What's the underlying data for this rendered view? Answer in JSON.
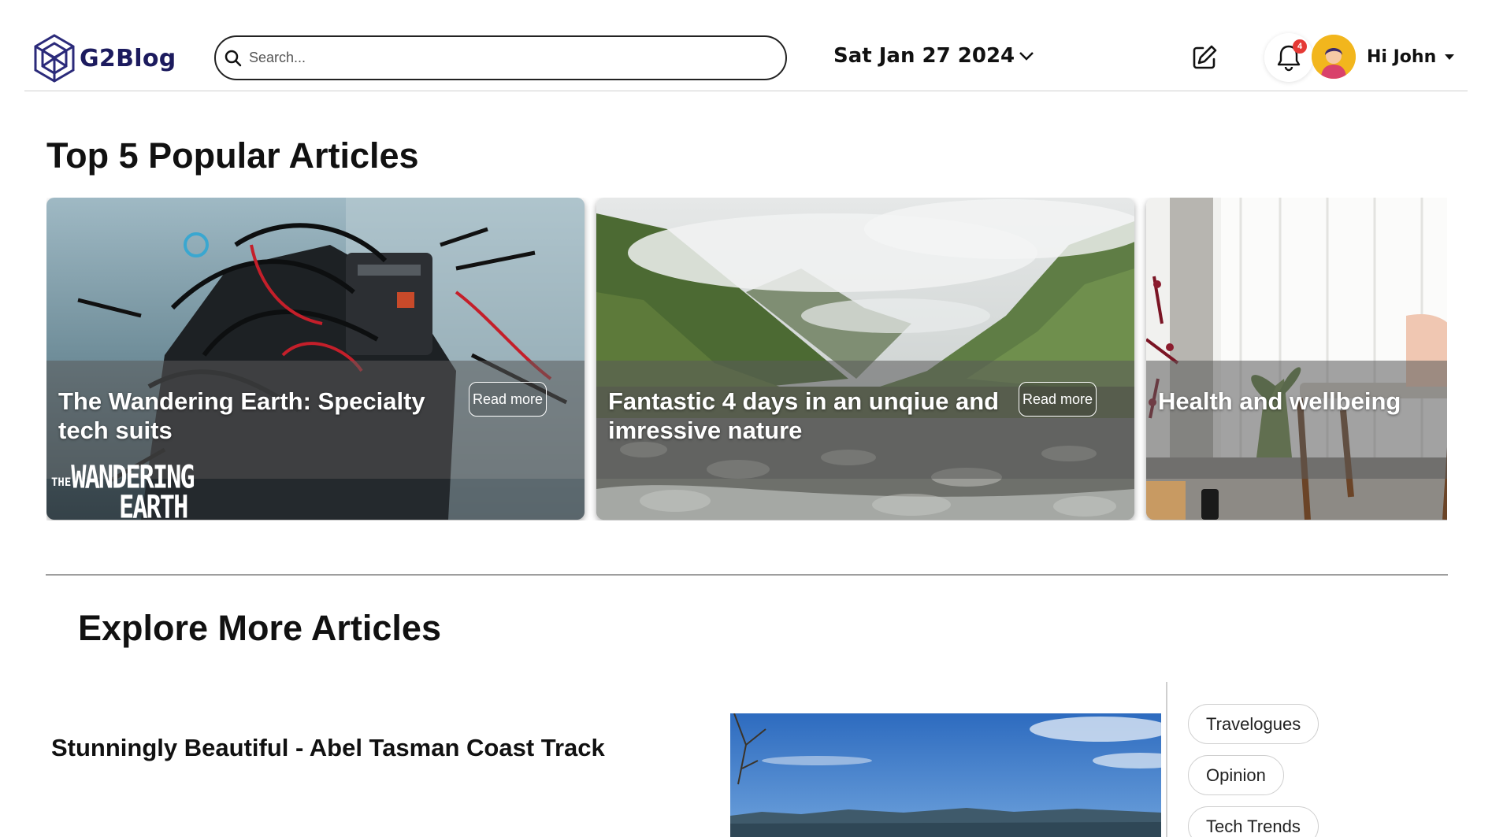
{
  "header": {
    "logo_text": "G2Blog",
    "search_placeholder": "Search...",
    "date_label": "Sat Jan 27 2024",
    "notification_count": "4",
    "greeting": "Hi John",
    "icons": [
      "search-icon",
      "chevron-down-icon",
      "edit-icon",
      "bell-icon",
      "caret-down-icon"
    ]
  },
  "popular": {
    "title": "Top 5 Popular Articles",
    "cards": [
      {
        "title": "The Wandering Earth: Specialty tech suits",
        "read_more": "Read more",
        "image_text_the": "THE",
        "image_text_wandering": "WANDERING",
        "image_text_earth": "EARTH"
      },
      {
        "title": "Fantastic 4 days in an unqiue and imressive nature",
        "read_more": "Read more"
      },
      {
        "title": "Health and wellbeing"
      }
    ]
  },
  "explore": {
    "title": "Explore More Articles",
    "article": {
      "title": "Stunningly Beautiful - Abel Tasman Coast Track"
    },
    "tags": [
      "Travelogues",
      "Opinion",
      "Tech Trends"
    ]
  },
  "colors": {
    "brand_navy": "#1c1b5e",
    "badge_red": "#e53935",
    "avatar_yellow": "#f2b61d"
  }
}
